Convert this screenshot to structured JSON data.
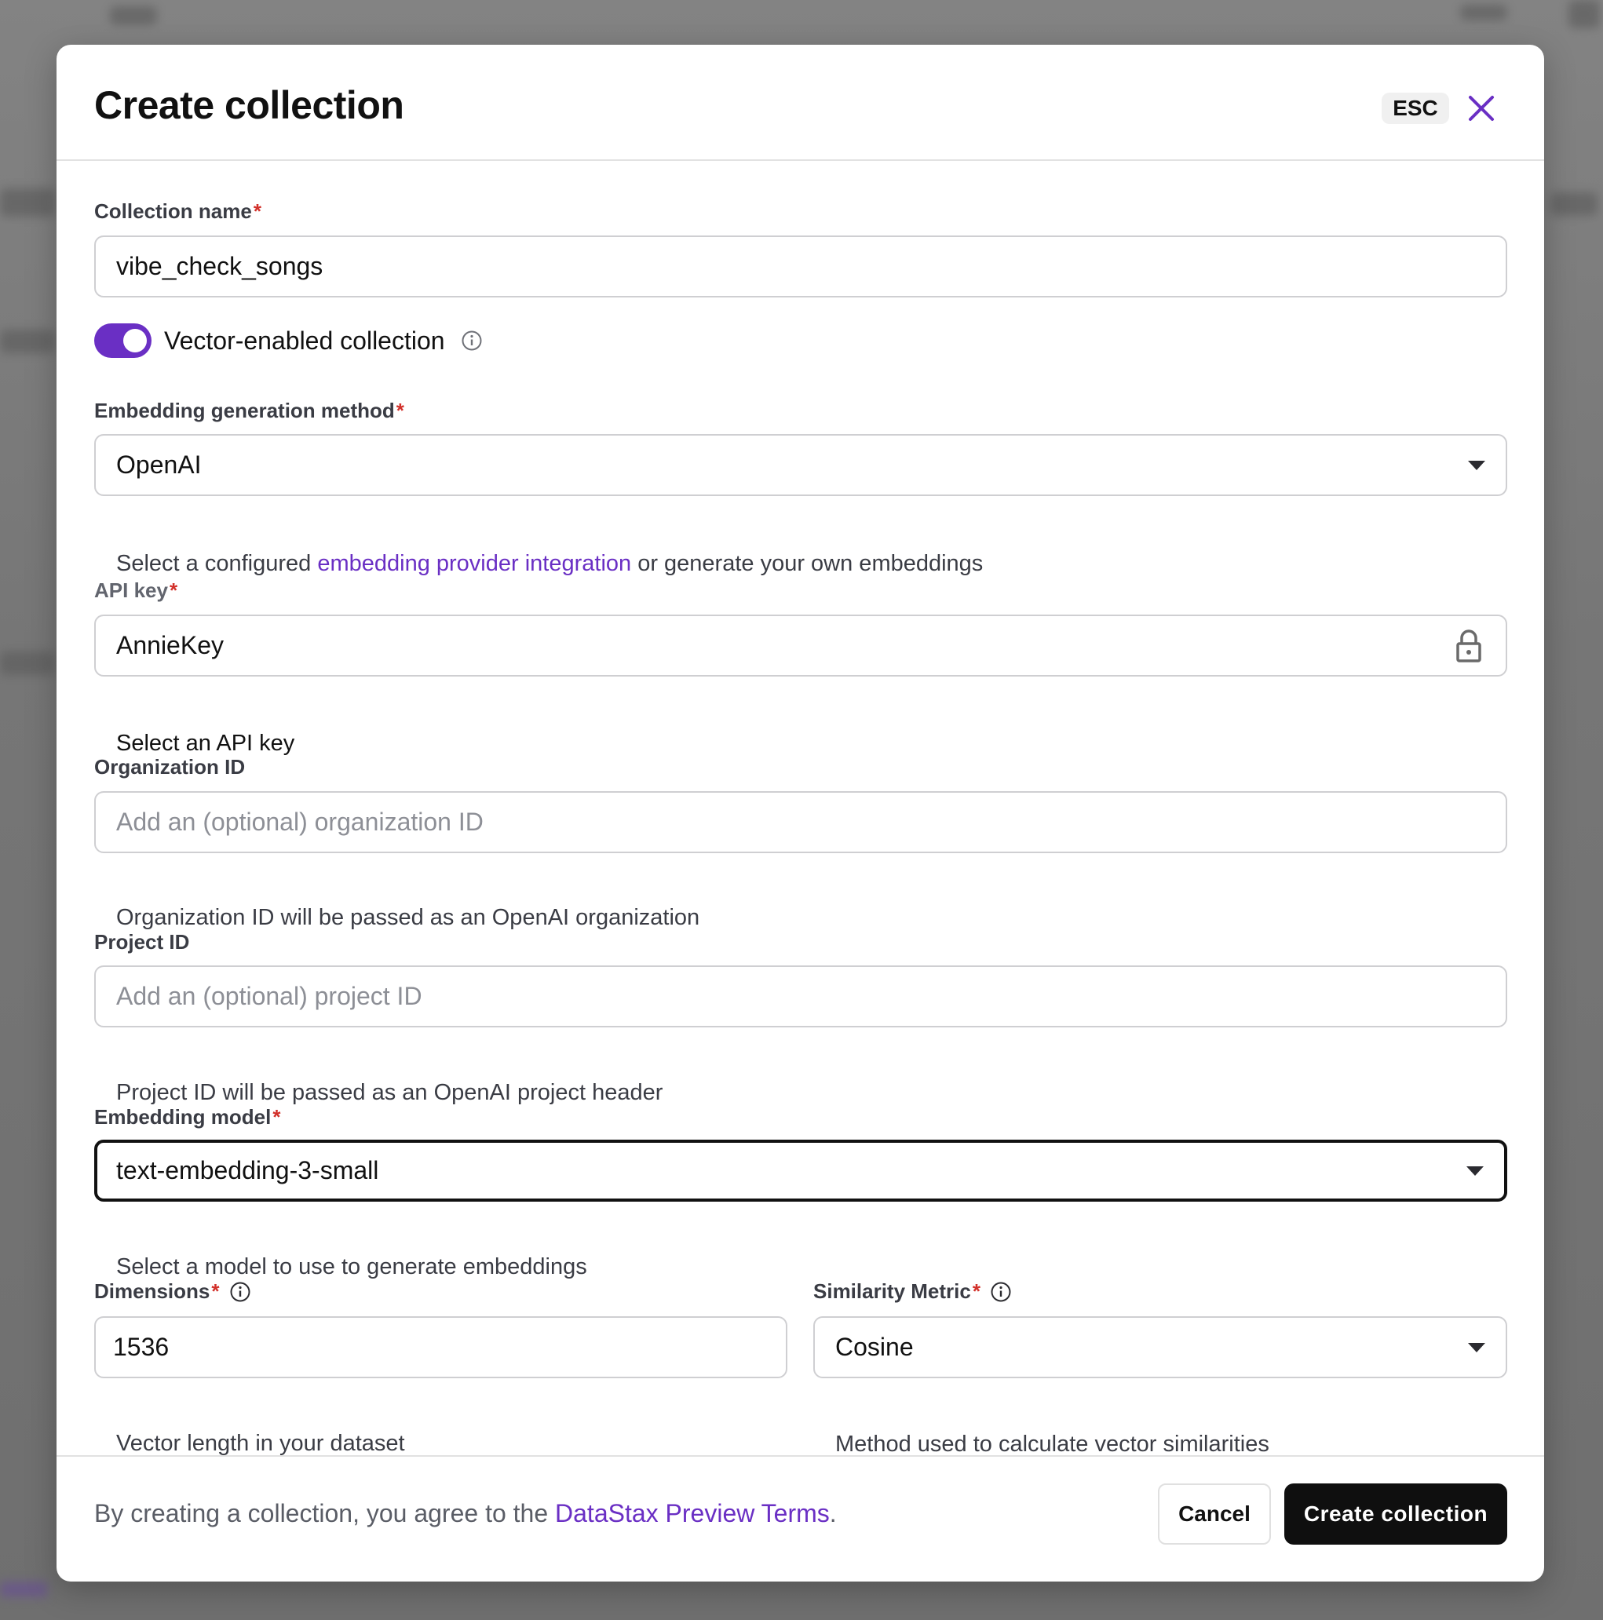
{
  "dialog": {
    "title": "Create collection",
    "esc_label": "ESC",
    "close_icon": "close-icon"
  },
  "fields": {
    "collection_name": {
      "label": "Collection name",
      "required": "*",
      "value": "vibe_check_songs"
    },
    "vector_toggle": {
      "label": "Vector-enabled collection",
      "enabled": true,
      "info_icon": "info-icon"
    },
    "embedding_method": {
      "label": "Embedding generation method",
      "required": "*",
      "value": "OpenAI",
      "helper_prefix": "Select a configured ",
      "helper_link": "embedding provider integration",
      "helper_suffix": " or generate your own embeddings"
    },
    "api_key": {
      "label": "API key",
      "required": "*",
      "value": "AnnieKey",
      "icon": "lock-icon",
      "helper": "Select an API key"
    },
    "organization_id": {
      "label": "Organization ID",
      "placeholder": "Add an (optional) organization ID",
      "value": "",
      "helper": "Organization ID will be passed as an OpenAI organization"
    },
    "project_id": {
      "label": "Project ID",
      "placeholder": "Add an (optional) project ID",
      "value": "",
      "helper": "Project ID will be passed as an OpenAI project header"
    },
    "embedding_model": {
      "label": "Embedding model",
      "required": "*",
      "value": "text-embedding-3-small",
      "helper": "Select a model to use to generate embeddings"
    },
    "dimensions": {
      "label": "Dimensions",
      "required": "*",
      "value": "1536",
      "helper": "Vector length in your dataset"
    },
    "similarity_metric": {
      "label": "Similarity Metric",
      "required": "*",
      "value": "Cosine",
      "helper": "Method used to calculate vector similarities"
    }
  },
  "footer": {
    "terms_prefix": "By creating a collection, you agree to the ",
    "terms_link": "DataStax Preview Terms",
    "terms_suffix": ".",
    "cancel_label": "Cancel",
    "create_label": "Create collection"
  },
  "colors": {
    "accent": "#6a2fc4",
    "required": "#d2302a",
    "primary_button": "#0f0f0f"
  }
}
